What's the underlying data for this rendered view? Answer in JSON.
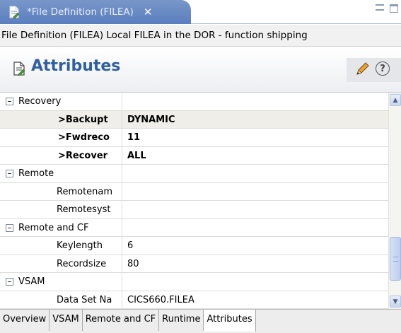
{
  "editor_tab": {
    "title": "*File Definition (FILEA)",
    "close_glyph": "✕",
    "icon": "file-edit-icon"
  },
  "window_controls": {
    "minimize_icon": "minimize-icon",
    "maximize_icon": "maximize-icon"
  },
  "description": "File Definition (FILEA) Local FILEA in the DOR - function shipping",
  "header": {
    "title": "Attributes",
    "icon": "file-edit-icon",
    "actions": [
      "pencil-icon",
      "help-icon"
    ],
    "help_glyph": "?"
  },
  "attributes": {
    "rows": [
      {
        "name": "Recovery",
        "value": "",
        "group": true
      },
      {
        "name": ">Backupt",
        "value": "DYNAMIC",
        "bold": true,
        "highlight": true
      },
      {
        "name": ">Fwdreco",
        "value": "11",
        "bold": true
      },
      {
        "name": ">Recover",
        "value": "ALL",
        "bold": true
      },
      {
        "name": "Remote",
        "value": "",
        "group": true
      },
      {
        "name": "Remotenam",
        "value": ""
      },
      {
        "name": "Remotesyst",
        "value": ""
      },
      {
        "name": "Remote and CF",
        "value": "",
        "group": true
      },
      {
        "name": "Keylength",
        "value": "6"
      },
      {
        "name": "Recordsize",
        "value": "80"
      },
      {
        "name": "VSAM",
        "value": "",
        "group": true
      },
      {
        "name": "Data Set Na",
        "value": "CICS660.FILEA"
      }
    ]
  },
  "scrollbar": {
    "up_glyph": "▲",
    "down_glyph": "▼"
  },
  "bottom_tabs": [
    {
      "label": "Overview",
      "active": false
    },
    {
      "label": "VSAM",
      "active": false
    },
    {
      "label": "Remote and CF",
      "active": false
    },
    {
      "label": "Runtime",
      "active": false
    },
    {
      "label": "Attributes",
      "active": true
    }
  ],
  "colors": {
    "tab_blue": "#5a7fbf",
    "header_title": "#2f5f9d",
    "row_highlight": "#efeee8"
  }
}
